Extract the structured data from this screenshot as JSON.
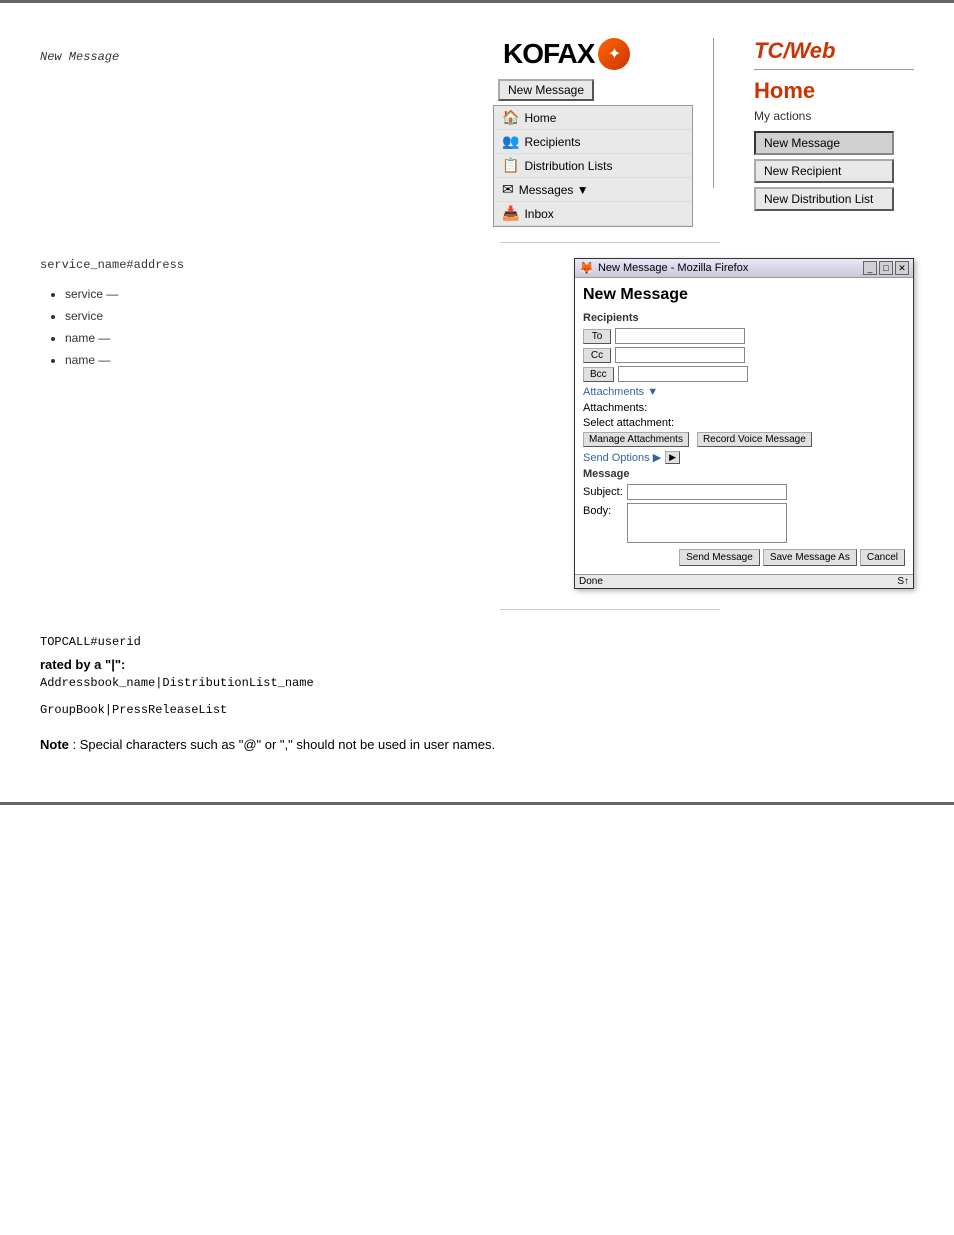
{
  "page": {
    "breadcrumb": "New Message",
    "logo": "KOFAX",
    "subtitle": "TC/Web",
    "home_title": "Home",
    "my_actions_label": "My actions"
  },
  "nav": {
    "new_message_btn": "New Message",
    "items": [
      {
        "label": "Home",
        "icon": "🏠"
      },
      {
        "label": "Recipients",
        "icon": "👥"
      },
      {
        "label": "Distribution Lists",
        "icon": "📋"
      },
      {
        "label": "Messages ▼",
        "icon": "✉"
      },
      {
        "label": "Inbox",
        "icon": "📥"
      }
    ]
  },
  "actions": {
    "new_message": "New Message",
    "new_recipient": "New Recipient",
    "new_distribution_list": "New Distribution List"
  },
  "firefox_window": {
    "title": "New Message - Mozilla Firefox",
    "heading": "New Message",
    "recipients_label": "Recipients",
    "to_btn": "To",
    "cc_btn": "Cc",
    "bcc_btn": "Bcc",
    "attachments_label": "Attachments ▼",
    "attachments_sub": "Attachments:",
    "select_attachment_label": "Select attachment:",
    "manage_attachments_btn": "Manage Attachments",
    "record_voice_btn": "Record Voice Message",
    "send_options_label": "Send Options ▶",
    "message_label": "Message",
    "subject_label": "Subject:",
    "body_label": "Body:",
    "send_btn": "Send Message",
    "save_btn": "Save Message As",
    "cancel_btn": "Cancel",
    "status_done": "Done",
    "status_icon": "S↑"
  },
  "content": {
    "address_format": "service_name#address",
    "bullet_items": [
      "service — ",
      "service",
      "name —",
      "name —"
    ],
    "topcall_example": "TOPCALL#userid",
    "rated_label": "rated by a \"|\":",
    "addressbook_format": "Addressbook_name|DistributionList_name",
    "groupbook_example": "GroupBook|PressReleaseList",
    "note_prefix": "Note",
    "note_text": ": Special characters such as \"@\" or \",\" should not be used in user names."
  }
}
